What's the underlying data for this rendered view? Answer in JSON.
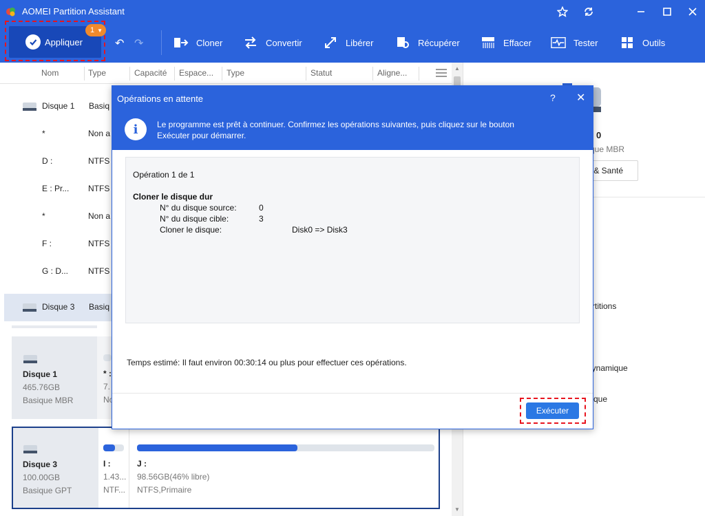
{
  "window": {
    "title": "AOMEI Partition Assistant"
  },
  "toolbar": {
    "apply_label": "Appliquer",
    "apply_badge": "1",
    "items": [
      {
        "label": "Cloner"
      },
      {
        "label": "Convertir"
      },
      {
        "label": "Libérer"
      },
      {
        "label": "Récupérer"
      },
      {
        "label": "Effacer"
      },
      {
        "label": "Tester"
      },
      {
        "label": "Outils"
      }
    ]
  },
  "table": {
    "columns": [
      "Nom",
      "Type",
      "Capacité",
      "Espace...",
      "Type",
      "Statut",
      "Aligne..."
    ],
    "rows": [
      {
        "name": "Disque 1",
        "type": "Basiq"
      },
      {
        "name": "*",
        "type": "Non a"
      },
      {
        "name": "D :",
        "type": "NTFS"
      },
      {
        "name": "E : Pr...",
        "type": "NTFS"
      },
      {
        "name": "*",
        "type": "Non a"
      },
      {
        "name": "F :",
        "type": "NTFS"
      },
      {
        "name": "G : D...",
        "type": "NTFS"
      },
      {
        "name": "Disque 3",
        "type": "Basiq"
      }
    ]
  },
  "cards": [
    {
      "name": "Disque 1",
      "size": "465.76GB",
      "kind": "Basique MBR",
      "part1_name": "* :",
      "part1_size": "7.",
      "part1_fs": "No"
    },
    {
      "name": "Disque 3",
      "size": "100.00GB",
      "kind": "Basique GPT",
      "part1_name": "I :",
      "part1_size": "1.43...",
      "part1_fs": "NTF...",
      "part2_name": "J :",
      "part2_size": "98.56GB(46% libre)",
      "part2_fs": "NTFS,Primaire",
      "part2_used": 0.54
    }
  ],
  "right_panel": {
    "disk_num": "0",
    "disk_kind": "que MBR",
    "health_label": "s & Santé",
    "item1": "rtitions",
    "item2": "dynamique",
    "item3": "que"
  },
  "dialog": {
    "title": "Opérations en attente",
    "help": "?",
    "close": "✕",
    "info_line1": "Le programme est prêt à continuer. Confirmez les opérations suivantes, puis cliquez sur le bouton",
    "info_line2": "Exécuter pour démarrer.",
    "op_header": "Opération 1 de 1",
    "op_title": "Cloner le disque dur",
    "src_label": "N° du disque source:",
    "src_value": "0",
    "dst_label": "N° du disque cible:",
    "dst_value": "3",
    "clone_label": "Cloner le disque:",
    "clone_value": "Disk0 => Disk3",
    "estimate": "Temps estimé: Il faut environ 00:30:14 ou plus pour effectuer ces opérations.",
    "execute_label": "Exécuter"
  },
  "colors": {
    "brand": "#2b63dc",
    "highlight": "#e8141e",
    "badge": "#f08a2c"
  }
}
